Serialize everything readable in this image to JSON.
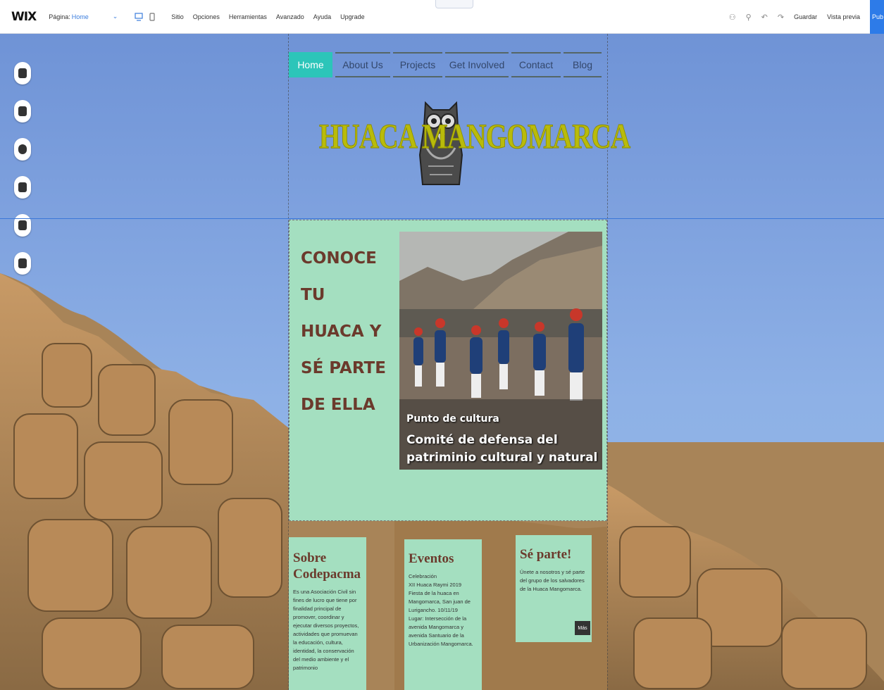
{
  "editor": {
    "logo": "WIX",
    "page_label": "Página:",
    "page_name": "Home",
    "menu": [
      "Sitio",
      "Opciones",
      "Herramientas",
      "Avanzado",
      "Ayuda",
      "Upgrade"
    ],
    "save_label": "Guardar",
    "preview_label": "Vista previa",
    "publish_label": "Pub"
  },
  "site": {
    "nav": [
      "Home",
      "About Us",
      "Projects",
      "Get Involved",
      "Contact",
      "Blog"
    ],
    "title": "HUACA MANGOMARCA",
    "hero_heading": [
      "Conoce",
      "tu",
      "huaca y",
      "sé parte",
      "de ella"
    ],
    "photo_caption_small": "Punto de cultura",
    "photo_caption_large": "Comité de defensa del patriminio cultural y natural",
    "about": {
      "title": "Sobre Codepacma",
      "text": "Es una Asociación Civil sin fines de lucro que tiene por finalidad principal de promover, coordinar y ejecutar diversos proyectos, actividades que promuevan la educación, cultura, identidad, la conservación del medio ambiente y el patrimonio"
    },
    "events": {
      "title": "Eventos",
      "lines": [
        "Celebración",
        "XII Huaca Raymi 2019",
        "Fiesta de la huaca en Mangomarca, San juan de Lurigancho. 10/11/19",
        "Lugar: Intersección de la avenida Mangomarca y avenida Santuario de la Urbanización Mangomarca."
      ]
    },
    "join": {
      "title": "Sé parte!",
      "text": "Únete a nosotros y sé parte del grupo de los salvadores de la Huaca Mangomarca.",
      "more": "Más"
    }
  },
  "colors": {
    "nav_active": "#2cc5b9",
    "strip_bg": "#a4dfc0",
    "title_color": "#b9bb0a",
    "heading_brown": "#6b3a2c",
    "publish_blue": "#2d7be8"
  }
}
